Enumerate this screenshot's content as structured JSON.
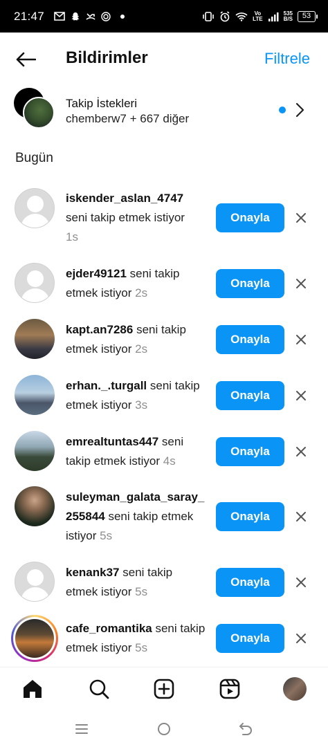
{
  "status_bar": {
    "time": "21:47",
    "network_top": "Vo",
    "network_bottom": "LTE",
    "speed_top": "535",
    "speed_bottom": "B/S",
    "battery": "53"
  },
  "header": {
    "title": "Bildirimler",
    "filter_label": "Filtrele"
  },
  "follow_requests": {
    "title": "Takip İstekleri",
    "subtitle": "chemberw7 + 667 diğer"
  },
  "section_title": "Bugün",
  "notifications": [
    {
      "username": "iskender_aslan_4747",
      "text": "seni takip etmek istiyor",
      "time": "1s",
      "button": "Onayla"
    },
    {
      "username": "ejder49121",
      "text": "seni takip etmek istiyor",
      "time": "2s",
      "button": "Onayla"
    },
    {
      "username": "kapt.an7286",
      "text": "seni takip etmek istiyor",
      "time": "2s",
      "button": "Onayla"
    },
    {
      "username": "erhan._.turgall",
      "text": "seni takip etmek istiyor",
      "time": "3s",
      "button": "Onayla"
    },
    {
      "username": "emrealtuntas447",
      "text": "seni takip etmek istiyor",
      "time": "4s",
      "button": "Onayla"
    },
    {
      "username": "suleyman_galata_saray_255844",
      "text": "seni takip etmek istiyor",
      "time": "5s",
      "button": "Onayla"
    },
    {
      "username": "kenank37",
      "text": "seni takip etmek istiyor",
      "time": "5s",
      "button": "Onayla"
    },
    {
      "username": "cafe_romantika",
      "text": "seni takip etmek istiyor",
      "time": "5s",
      "button": "Onayla"
    }
  ],
  "accent_color": "#0a95f6",
  "bottom_nav": [
    "home-icon",
    "search-icon",
    "create-post-icon",
    "reels-icon",
    "profile-avatar"
  ]
}
